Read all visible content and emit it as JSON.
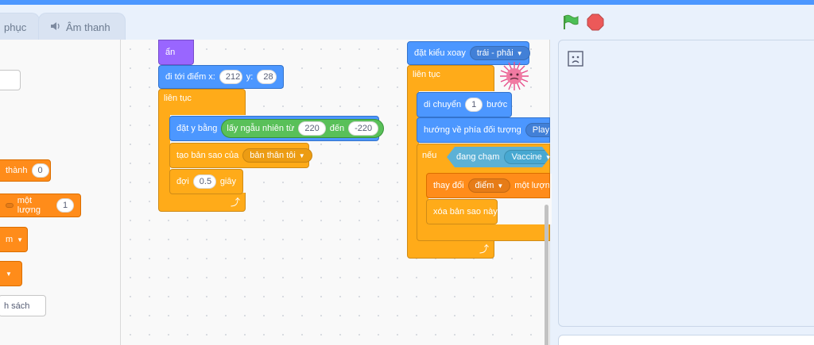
{
  "tabs": {
    "costumes_partial": "phục",
    "sounds_label": "Âm thanh"
  },
  "palette": {
    "set_var_suffix": "thành",
    "set_var_value": "0",
    "change_var_label": "một lượng",
    "change_var_value": "1",
    "var_dropdown_partial": "m",
    "list_partial": "h sách"
  },
  "script1": {
    "hide_label": "ẩn",
    "goto_label": "đi tới điểm x:",
    "goto_x": "212",
    "goto_y_label": "y:",
    "goto_y": "28",
    "forever_label": "liên tục",
    "set_y_label": "đặt y bằng",
    "random_label": "lấy ngẫu nhiên từ",
    "random_from": "220",
    "random_to_label": "đến",
    "random_to": "-220",
    "clone_label": "tạo bản sao của",
    "clone_target": "bản thân tôi",
    "wait_label": "đợi",
    "wait_value": "0.5",
    "wait_unit": "giây"
  },
  "script2": {
    "rotation_label": "đặt kiểu xoay",
    "rotation_value": "trái - phải",
    "forever_label": "liên tục",
    "move_label": "di chuyển",
    "move_value": "1",
    "move_unit": "bước",
    "point_label": "hướng về phía đối tượng",
    "point_target": "Player",
    "if_label": "nếu",
    "touching_label": "đang chạm",
    "touching_target": "Vaccine",
    "change_label": "thay đổi",
    "change_var": "điểm",
    "change_amount_label": "một lượng",
    "delete_clone_label": "xóa bản sao này"
  },
  "icons": {
    "green_flag": "#4cbf56",
    "stop": "#ec5959",
    "accent": "#4c97ff"
  }
}
